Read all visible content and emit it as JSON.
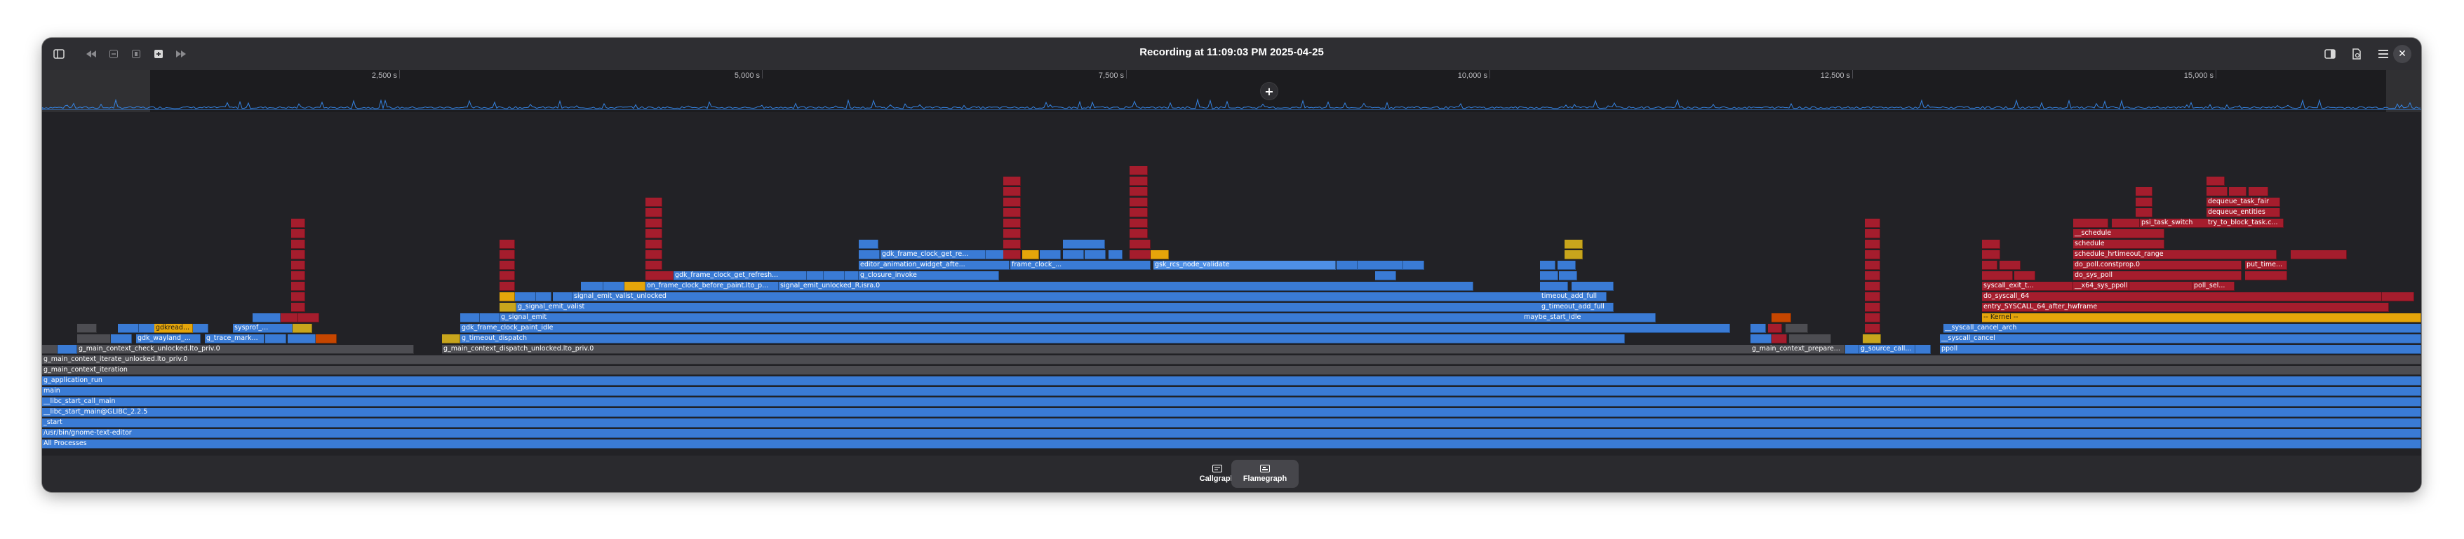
{
  "window": {
    "title": "Recording at 11:09:03 PM 2025-04-25"
  },
  "headerbar": {
    "left_icons": [
      "sidebar-toggle-icon",
      "seek-backward-icon",
      "zoom-out-icon",
      "zoom-fit-icon",
      "zoom-in-icon",
      "seek-forward-icon"
    ],
    "right_icons": [
      "right-panel-icon",
      "document-properties-icon",
      "main-menu-icon"
    ],
    "close_glyph": "✕"
  },
  "timeline": {
    "ticks": [
      {
        "label": "2,500 s"
      },
      {
        "label": "5,000 s"
      },
      {
        "label": "7,500 s"
      },
      {
        "label": "10,000 s"
      },
      {
        "label": "12,500 s"
      },
      {
        "label": "15,000 s"
      }
    ],
    "zoom_glyph": "+"
  },
  "flamegraph": {
    "base_rows": [
      "All Processes",
      "/usr/bin/gnome-text-editor",
      "_start",
      "__libc_start_main@GLIBC_2.2.5",
      "__libc_start_call_main",
      "main",
      "g_application_run",
      "g_main_context_iteration",
      "g_main_context_iterate_unlocked.lto_priv.0"
    ],
    "frames": [
      {
        "t": "g_main_context_dispatch_unlocked.lto_priv.0",
        "c": "c-g"
      },
      {
        "t": "g_timeout_dispatch",
        "c": "c-b1"
      },
      {
        "t": "gdk_frame_clock_paint_idle",
        "c": "c-b1"
      },
      {
        "t": "g_signal_emit",
        "c": "c-b1"
      },
      {
        "t": "g_signal_emit_valist",
        "c": "c-b1"
      },
      {
        "t": "signal_emit_valist_unlocked",
        "c": "c-b1"
      },
      {
        "t": "signal_emit_unlocked_R.isra.0",
        "c": "c-b1"
      },
      {
        "t": "g_closure_invoke",
        "c": "c-b1"
      },
      {
        "t": "editor_animation_widget_afte...",
        "c": "c-b1"
      },
      {
        "t": "gdk_frame_clock_get_re...",
        "c": "c-b1"
      },
      {
        "t": "gsk_rcs_node_validate",
        "c": "c-b3"
      },
      {
        "t": "on_frame_clock_before_paint.lto_p...",
        "c": "c-b1"
      },
      {
        "t": "gdk_frame_clock_get_refresh...",
        "c": "c-b1"
      },
      {
        "t": "frame_clock_...",
        "c": "c-b1"
      },
      {
        "t": "g_main_context_check_unlocked.lto_priv.0",
        "c": "c-g"
      },
      {
        "t": "gdk_wayland_...",
        "c": "c-b1"
      },
      {
        "t": "g_trace_mark...",
        "c": "c-b1"
      },
      {
        "t": "sysprof_...",
        "c": "c-b1"
      },
      {
        "t": "gdkread...",
        "c": "c-sel"
      },
      {
        "t": "g_main_context_prepare...",
        "c": "c-g"
      },
      {
        "t": "g_source_call...",
        "c": "c-b1"
      },
      {
        "t": "ppoll",
        "c": "c-b1"
      },
      {
        "t": "__syscall_cancel",
        "c": "c-b1"
      },
      {
        "t": "__syscall_cancel_arch",
        "c": "c-b1"
      },
      {
        "t": "-- Kernel --",
        "c": "c-sel"
      },
      {
        "t": "entry_SYSCALL_64_after_hwframe",
        "c": "c-r1"
      },
      {
        "t": "do_syscall_64",
        "c": "c-r1"
      },
      {
        "t": "__x64_sys_ppoll",
        "c": "c-r1"
      },
      {
        "t": "do_sys_poll",
        "c": "c-r1"
      },
      {
        "t": "do_poll.constprop.0",
        "c": "c-r1"
      },
      {
        "t": "schedule_hrtimeout_range",
        "c": "c-r1"
      },
      {
        "t": "schedule",
        "c": "c-r1"
      },
      {
        "t": "__schedule",
        "c": "c-r1"
      },
      {
        "t": "psi_task_switch",
        "c": "c-r1"
      },
      {
        "t": "dequeue_entities",
        "c": "c-r1"
      },
      {
        "t": "dequeue_task_fair",
        "c": "c-r1"
      },
      {
        "t": "try_to_block_task.c...",
        "c": "c-r1"
      },
      {
        "t": "maybe_start_idle",
        "c": "c-b1"
      },
      {
        "t": "g_timeout_add_full",
        "c": "c-b1"
      },
      {
        "t": "timeout_add_full",
        "c": "c-b1"
      },
      {
        "t": "syscall_exit_t...",
        "c": "c-r1"
      },
      {
        "t": "poll_sel...",
        "c": "c-r1"
      },
      {
        "t": "put_time...",
        "c": "c-r1"
      }
    ]
  },
  "view_switcher": [
    {
      "label": "Callgraph",
      "active": false
    },
    {
      "label": "Flamegraph",
      "active": true
    }
  ]
}
